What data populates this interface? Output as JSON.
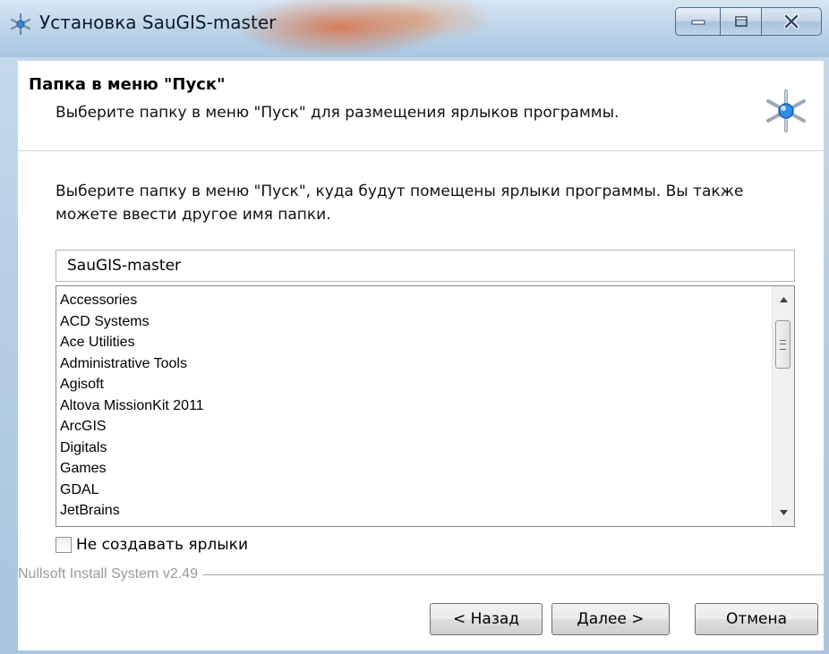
{
  "window": {
    "title": "Установка SauGIS-master",
    "controls": {
      "minimize": "—",
      "maximize": "☐",
      "close": "X"
    }
  },
  "header": {
    "title": "Папка в меню \"Пуск\"",
    "subtitle": "Выберите папку в меню \"Пуск\" для размещения ярлыков программы.",
    "icon": "setup-sparkle-icon"
  },
  "body": {
    "description": "Выберите папку в меню \"Пуск\", куда будут помещены ярлыки программы. Вы также можете ввести другое имя папки.",
    "folder_input_value": "SauGIS-master",
    "folders": [
      "Accessories",
      "ACD Systems",
      "Ace Utilities",
      "Administrative Tools",
      "Agisoft",
      "Altova MissionKit 2011",
      "ArcGIS",
      "Digitals",
      "Games",
      "GDAL",
      "JetBrains"
    ],
    "checkbox_label": "Не создавать ярлыки",
    "checkbox_checked": false,
    "branding": "Nullsoft Install System v2.49"
  },
  "buttons": {
    "back": "< Назад",
    "next": "Далее >",
    "cancel": "Отмена"
  },
  "colors": {
    "titlebar_glow": "#dc5f28",
    "frame": "#b8cfe6",
    "branding_text": "#9a9a9a"
  }
}
